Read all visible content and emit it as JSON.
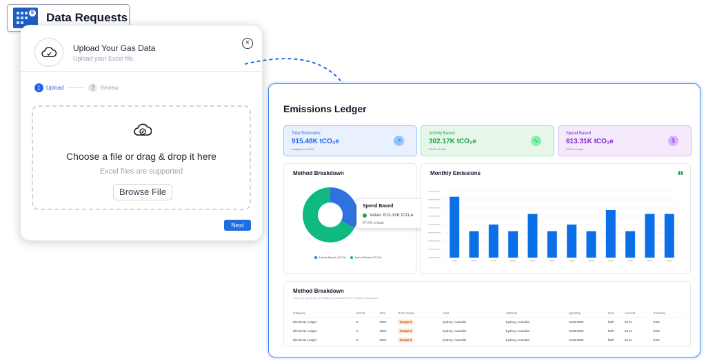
{
  "header": {
    "title": "Data Requests",
    "icon": "building-icon"
  },
  "upload": {
    "title": "Upload Your Gas Data",
    "subtitle": "Upload your Excel file.",
    "steps": [
      {
        "number": "1",
        "label": "Upload"
      },
      {
        "number": "2",
        "label": "Review"
      }
    ],
    "dropzone": {
      "title": "Choose a file or drag & drop it here",
      "subtitle": "Excel files are supported",
      "browse_label": "Browse File"
    },
    "next_label": "Next"
  },
  "ledger": {
    "title": "Emissions Ledger",
    "kpis": [
      {
        "label": "Total Emissions",
        "value": "915.48K tCO₂e",
        "note": "Analytics for 2023",
        "icon": "trend-up-icon",
        "color": "#2563eb",
        "bg": "#e8f1fd",
        "border": "#93c5fd"
      },
      {
        "label": "Activity Based",
        "value": "302.17K tCO₂e",
        "note": "33.0% of total",
        "icon": "activity-icon",
        "color": "#16a34a",
        "bg": "#e6f7ea",
        "border": "#86efac"
      },
      {
        "label": "Spend Based",
        "value": "613.31K tCO₂e",
        "note": "67.0% of total",
        "icon": "dollar-icon",
        "color": "#7e22ce",
        "bg": "#f5e9fc",
        "border": "#d8b4fe"
      }
    ],
    "breakdown": {
      "title": "Method Breakdown",
      "legend": [
        {
          "label": "Activity Based (33.0%)",
          "color": "#2e73dd"
        },
        {
          "label": "Spend Based (67.0%)",
          "color": "#10b981"
        }
      ],
      "tooltip": {
        "title": "Spend Based",
        "value": "Value: 613.31K tCO₂e",
        "note": "67.0% of total"
      }
    },
    "monthly": {
      "title": "Monthly Emissions",
      "icon": "chart-icon"
    },
    "table": {
      "title": "Method Breakdown",
      "subtitle": "Click any row to see a detailed breakdown of the emission calculation.",
      "columns": [
        "Category",
        "Month",
        "Year",
        "GHG Scope",
        "Alias",
        "Attribute",
        "Quantity",
        "Unit",
        "Amount",
        "Currency"
      ],
      "rows": [
        [
          "Electricity Ledger",
          "5",
          "2023",
          "Scope 2",
          "Sydney, Australia",
          "Sydney, Australia",
          "5328.0000",
          "kWh",
          "32.24",
          "USD"
        ],
        [
          "Electricity Ledger",
          "5",
          "2023",
          "Scope 2",
          "Sydney, Australia",
          "Sydney, Australia",
          "5328.0000",
          "kWh",
          "32.24",
          "USD"
        ],
        [
          "Electricity Ledger",
          "5",
          "2023",
          "Scope 2",
          "Sydney, Australia",
          "Sydney, Australia",
          "5328.0000",
          "kWh",
          "32.24",
          "USD"
        ]
      ]
    }
  },
  "chart_data": [
    {
      "type": "pie",
      "title": "Method Breakdown",
      "categories": [
        "Activity Based",
        "Spend Based"
      ],
      "values": [
        33.0,
        67.0
      ],
      "donut": true,
      "colors": [
        "#2e73dd",
        "#10b981"
      ]
    },
    {
      "type": "bar",
      "title": "Monthly Emissions",
      "values": [
        92,
        40,
        50,
        40,
        66,
        40,
        50,
        40,
        72,
        40,
        66,
        66
      ],
      "color": "#0b6fe8",
      "grid": true
    }
  ]
}
